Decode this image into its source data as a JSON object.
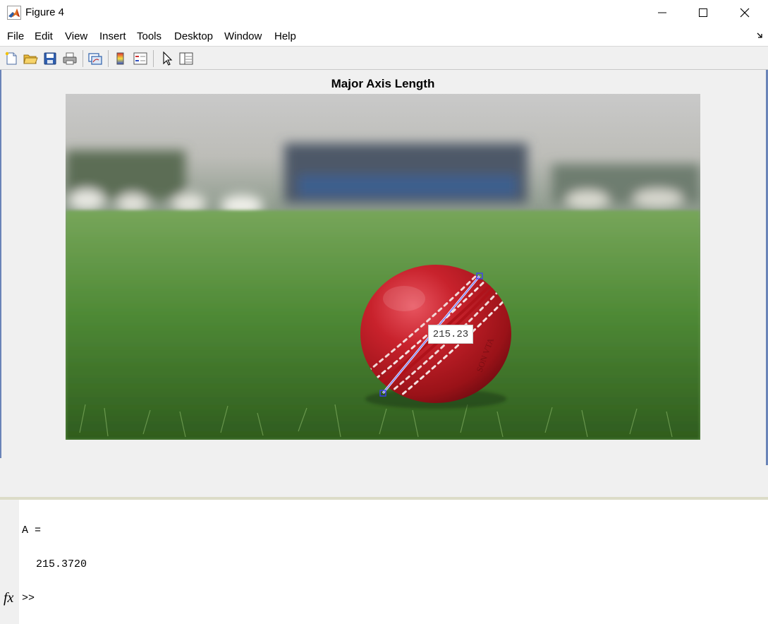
{
  "window": {
    "title": "Figure 4",
    "controls": {
      "minimize": "minimize-icon",
      "maximize": "maximize-icon",
      "close": "close-icon"
    }
  },
  "menubar": {
    "items": [
      "File",
      "Edit",
      "View",
      "Insert",
      "Tools",
      "Desktop",
      "Window",
      "Help"
    ]
  },
  "toolbar": {
    "buttons": [
      "new-figure-icon",
      "open-file-icon",
      "save-icon",
      "print-icon",
      "link-plot-icon",
      "colorbar-icon",
      "legend-icon",
      "pointer-icon",
      "property-inspector-icon"
    ]
  },
  "figure": {
    "axes_title": "Major Axis Length",
    "image_subject": "red cricket ball on grass",
    "distance_tool": {
      "label": "215.23",
      "color": "#7b7bff"
    }
  },
  "command_window": {
    "var_line": "A =",
    "value_line": "215.3720",
    "prompt": ">>",
    "fx_label": "fx"
  },
  "colors": {
    "figure_bg": "#f0f0f0",
    "window_border": "#6a84b8",
    "ball_red": "#c8222c",
    "grass_green": "#3f7d2a"
  }
}
